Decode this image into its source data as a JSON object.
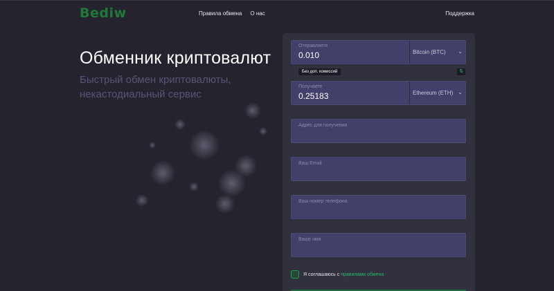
{
  "header": {
    "logo": "Bediw",
    "nav": [
      "Правила обмена",
      "О нас"
    ],
    "support": "Поддержка"
  },
  "hero": {
    "title": "Обменник криптовалют",
    "subtitle": "Быстрый обмен криптовалюты, некастодиальный сервис"
  },
  "exchange": {
    "send": {
      "label": "Отправляете",
      "value": "0.010",
      "currency": "Bitcoin (BTC)"
    },
    "fee_badge": "Без доп. комиссий",
    "receive": {
      "label": "Получаете",
      "value": "0.25183",
      "currency": "Ethereum (ETH)"
    },
    "inputs": [
      {
        "placeholder": "Адрес для получения"
      },
      {
        "placeholder": "Ваш Email"
      },
      {
        "placeholder": "Ваш номер телефона"
      },
      {
        "placeholder": "Ваше имя"
      }
    ],
    "agree_text": "Я соглашаюсь с ",
    "agree_link": "правилами обмена"
  },
  "colors": {
    "background": "#25242e",
    "panel": "#31303d",
    "field": "#42406a",
    "accent": "#24b96b",
    "logo": "#1f7a3a"
  },
  "icons": {
    "swap": "swap-arrows-icon",
    "chevron": "chevron-down-icon"
  }
}
